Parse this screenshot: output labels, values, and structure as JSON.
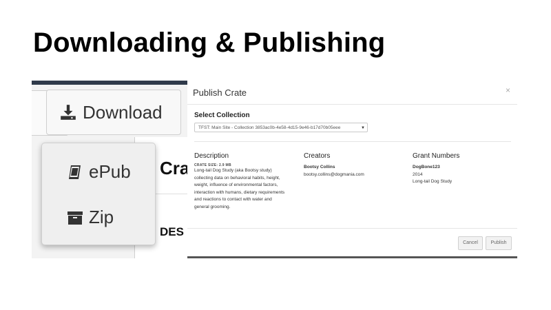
{
  "slide": {
    "title": "Downloading & Publishing"
  },
  "download": {
    "button_label": "Download",
    "menu": [
      {
        "label": "ePub",
        "icon": "book-icon"
      },
      {
        "label": "Zip",
        "icon": "archive-icon"
      }
    ],
    "cutoff_header": "Cra",
    "cutoff_row": "DES"
  },
  "modal": {
    "title": "Publish Crate",
    "close": "×",
    "select_label": "Select Collection",
    "select_value": "TFST: Main Site - Collection 3853ac0b-4e58-4d15-9e46-b17d70b05eee",
    "description": {
      "heading": "Description",
      "crate_size": "CRATE SIZE: 2.9 MB",
      "lines": [
        "Long-tail Dog Study (aka Bootsy study)",
        "collecting data on behavioral habits, height,",
        "weight, influence of environmental factors,",
        "interaction with humans, dietary requirements",
        "and reactions to contact with water and",
        "general grooming."
      ]
    },
    "creators": {
      "heading": "Creators",
      "name": "Bootsy Collins",
      "email": "bootsy.collins@dogmania.com"
    },
    "grants": {
      "heading": "Grant Numbers",
      "id": "DogBone123",
      "year": "2014",
      "name": "Long-tail Dog Study"
    },
    "buttons": {
      "cancel": "Cancel",
      "publish": "Publish"
    }
  }
}
